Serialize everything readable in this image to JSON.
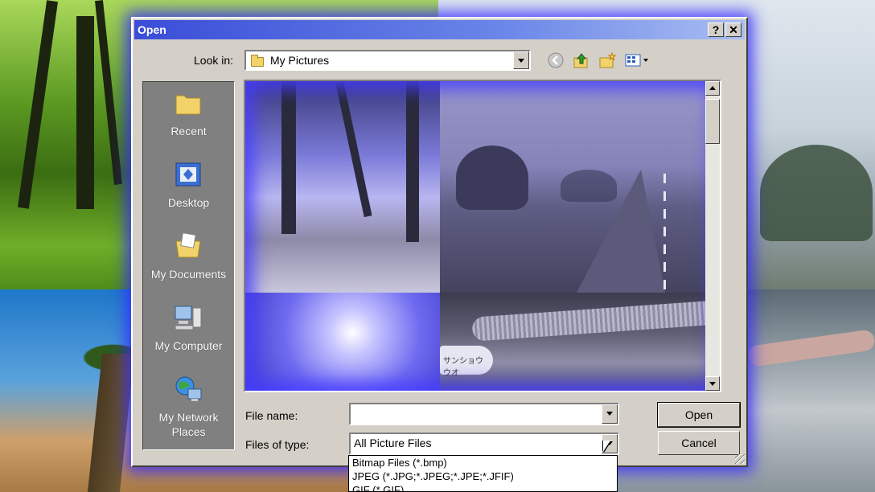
{
  "dialog": {
    "title": "Open",
    "help_button": "?",
    "close_button": "✕"
  },
  "look_in": {
    "label": "Look in:",
    "value": "My Pictures"
  },
  "toolbar": {
    "icons": [
      "back-icon",
      "up-folder-icon",
      "new-folder-icon",
      "view-menu-icon"
    ]
  },
  "places": [
    {
      "label": "Recent",
      "icon": "recent-folder-icon"
    },
    {
      "label": "Desktop",
      "icon": "desktop-icon"
    },
    {
      "label": "My Documents",
      "icon": "my-documents-icon"
    },
    {
      "label": "My Computer",
      "icon": "my-computer-icon"
    },
    {
      "label": "My Network Places",
      "icon": "network-places-icon"
    }
  ],
  "thumbnails": {
    "sign_text": "サンショウウオ"
  },
  "file_name": {
    "label": "File name:",
    "value": ""
  },
  "files_of_type": {
    "label": "Files of type:",
    "value": "All Picture Files",
    "options": [
      "Bitmap Files (*.bmp)",
      "JPEG (*.JPG;*.JPEG;*.JPE;*.JFIF)",
      "GIF (*.GIF)"
    ]
  },
  "buttons": {
    "open": "Open",
    "cancel": "Cancel"
  },
  "colors": {
    "dialog_face": "#d4d0c8",
    "title_bar": "#3a4cd8",
    "glow": "#3a2cff"
  }
}
